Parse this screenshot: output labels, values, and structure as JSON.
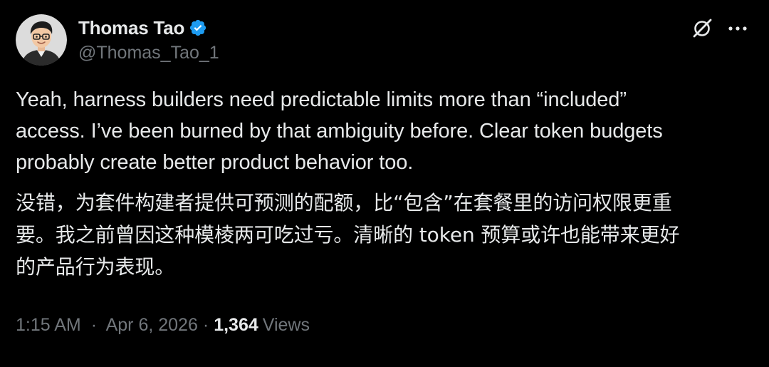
{
  "tweet": {
    "author": {
      "display_name": "Thomas Tao",
      "handle": "@Thomas_Tao_1",
      "verified": true
    },
    "actions": {
      "grok_icon": "grok-icon",
      "more_icon": "more-horizontal-icon"
    },
    "text_en": "Yeah, harness builders need predictable limits more than “included”\naccess. I’ve been burned by that ambiguity before. Clear token budgets\nprobably create better product behavior too.",
    "text_zh": "没错，为套件构建者提供可预测的配额，比“包含”在套餐里的访问权限更重\n要。我之前曾因这种模棱两可吃过亏。清晰的 token 预算或许也能带来更好\n的产品行为表现。",
    "meta": {
      "time": "1:15 AM",
      "separator": "·",
      "date": "Apr 6, 2026",
      "views_count": "1,364",
      "views_label": "Views"
    }
  },
  "colors": {
    "background": "#000000",
    "text_primary": "#e7e9ea",
    "text_secondary": "#71767b",
    "verified_badge": "#1d9bf0"
  }
}
